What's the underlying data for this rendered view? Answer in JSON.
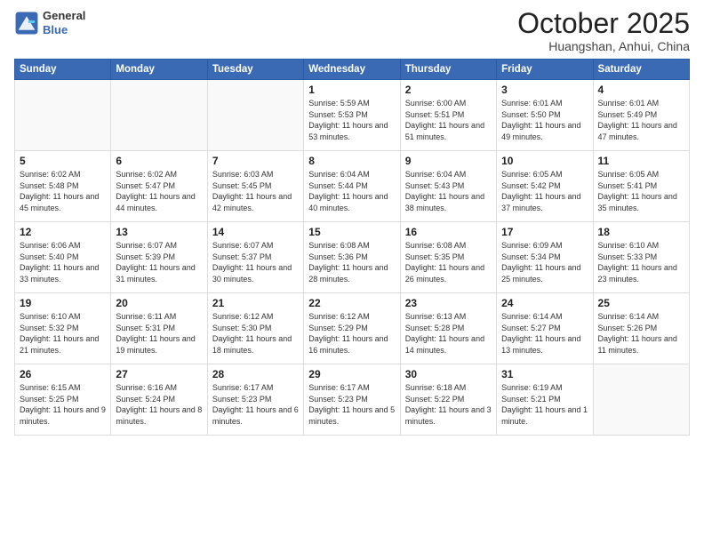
{
  "header": {
    "logo_line1": "General",
    "logo_line2": "Blue",
    "month": "October 2025",
    "location": "Huangshan, Anhui, China"
  },
  "weekdays": [
    "Sunday",
    "Monday",
    "Tuesday",
    "Wednesday",
    "Thursday",
    "Friday",
    "Saturday"
  ],
  "weeks": [
    [
      {
        "day": "",
        "info": ""
      },
      {
        "day": "",
        "info": ""
      },
      {
        "day": "",
        "info": ""
      },
      {
        "day": "1",
        "info": "Sunrise: 5:59 AM\nSunset: 5:53 PM\nDaylight: 11 hours and 53 minutes."
      },
      {
        "day": "2",
        "info": "Sunrise: 6:00 AM\nSunset: 5:51 PM\nDaylight: 11 hours and 51 minutes."
      },
      {
        "day": "3",
        "info": "Sunrise: 6:01 AM\nSunset: 5:50 PM\nDaylight: 11 hours and 49 minutes."
      },
      {
        "day": "4",
        "info": "Sunrise: 6:01 AM\nSunset: 5:49 PM\nDaylight: 11 hours and 47 minutes."
      }
    ],
    [
      {
        "day": "5",
        "info": "Sunrise: 6:02 AM\nSunset: 5:48 PM\nDaylight: 11 hours and 45 minutes."
      },
      {
        "day": "6",
        "info": "Sunrise: 6:02 AM\nSunset: 5:47 PM\nDaylight: 11 hours and 44 minutes."
      },
      {
        "day": "7",
        "info": "Sunrise: 6:03 AM\nSunset: 5:45 PM\nDaylight: 11 hours and 42 minutes."
      },
      {
        "day": "8",
        "info": "Sunrise: 6:04 AM\nSunset: 5:44 PM\nDaylight: 11 hours and 40 minutes."
      },
      {
        "day": "9",
        "info": "Sunrise: 6:04 AM\nSunset: 5:43 PM\nDaylight: 11 hours and 38 minutes."
      },
      {
        "day": "10",
        "info": "Sunrise: 6:05 AM\nSunset: 5:42 PM\nDaylight: 11 hours and 37 minutes."
      },
      {
        "day": "11",
        "info": "Sunrise: 6:05 AM\nSunset: 5:41 PM\nDaylight: 11 hours and 35 minutes."
      }
    ],
    [
      {
        "day": "12",
        "info": "Sunrise: 6:06 AM\nSunset: 5:40 PM\nDaylight: 11 hours and 33 minutes."
      },
      {
        "day": "13",
        "info": "Sunrise: 6:07 AM\nSunset: 5:39 PM\nDaylight: 11 hours and 31 minutes."
      },
      {
        "day": "14",
        "info": "Sunrise: 6:07 AM\nSunset: 5:37 PM\nDaylight: 11 hours and 30 minutes."
      },
      {
        "day": "15",
        "info": "Sunrise: 6:08 AM\nSunset: 5:36 PM\nDaylight: 11 hours and 28 minutes."
      },
      {
        "day": "16",
        "info": "Sunrise: 6:08 AM\nSunset: 5:35 PM\nDaylight: 11 hours and 26 minutes."
      },
      {
        "day": "17",
        "info": "Sunrise: 6:09 AM\nSunset: 5:34 PM\nDaylight: 11 hours and 25 minutes."
      },
      {
        "day": "18",
        "info": "Sunrise: 6:10 AM\nSunset: 5:33 PM\nDaylight: 11 hours and 23 minutes."
      }
    ],
    [
      {
        "day": "19",
        "info": "Sunrise: 6:10 AM\nSunset: 5:32 PM\nDaylight: 11 hours and 21 minutes."
      },
      {
        "day": "20",
        "info": "Sunrise: 6:11 AM\nSunset: 5:31 PM\nDaylight: 11 hours and 19 minutes."
      },
      {
        "day": "21",
        "info": "Sunrise: 6:12 AM\nSunset: 5:30 PM\nDaylight: 11 hours and 18 minutes."
      },
      {
        "day": "22",
        "info": "Sunrise: 6:12 AM\nSunset: 5:29 PM\nDaylight: 11 hours and 16 minutes."
      },
      {
        "day": "23",
        "info": "Sunrise: 6:13 AM\nSunset: 5:28 PM\nDaylight: 11 hours and 14 minutes."
      },
      {
        "day": "24",
        "info": "Sunrise: 6:14 AM\nSunset: 5:27 PM\nDaylight: 11 hours and 13 minutes."
      },
      {
        "day": "25",
        "info": "Sunrise: 6:14 AM\nSunset: 5:26 PM\nDaylight: 11 hours and 11 minutes."
      }
    ],
    [
      {
        "day": "26",
        "info": "Sunrise: 6:15 AM\nSunset: 5:25 PM\nDaylight: 11 hours and 9 minutes."
      },
      {
        "day": "27",
        "info": "Sunrise: 6:16 AM\nSunset: 5:24 PM\nDaylight: 11 hours and 8 minutes."
      },
      {
        "day": "28",
        "info": "Sunrise: 6:17 AM\nSunset: 5:23 PM\nDaylight: 11 hours and 6 minutes."
      },
      {
        "day": "29",
        "info": "Sunrise: 6:17 AM\nSunset: 5:23 PM\nDaylight: 11 hours and 5 minutes."
      },
      {
        "day": "30",
        "info": "Sunrise: 6:18 AM\nSunset: 5:22 PM\nDaylight: 11 hours and 3 minutes."
      },
      {
        "day": "31",
        "info": "Sunrise: 6:19 AM\nSunset: 5:21 PM\nDaylight: 11 hours and 1 minute."
      },
      {
        "day": "",
        "info": ""
      }
    ]
  ]
}
